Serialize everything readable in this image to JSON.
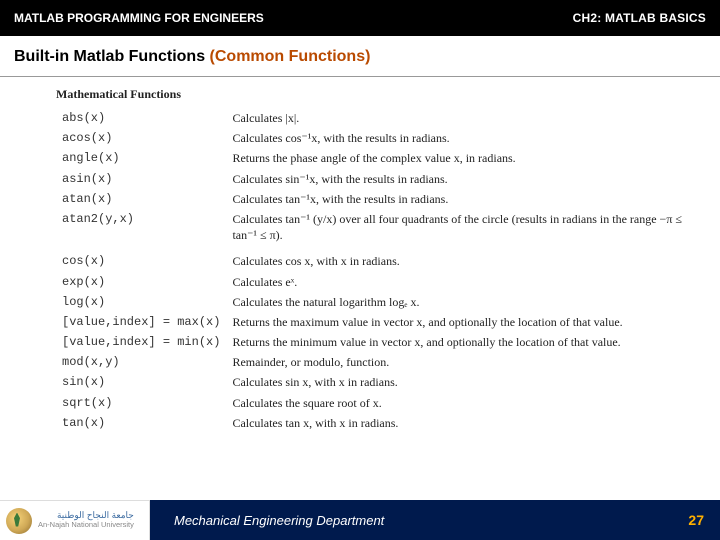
{
  "header": {
    "left": "MATLAB PROGRAMMING FOR ENGINEERS",
    "right_prefix": "CH2: ",
    "right_main": "MATLAB BASICS"
  },
  "title": {
    "main": "Built-in Matlab Functions ",
    "paren": "(Common Functions)"
  },
  "section_heading": "Mathematical Functions",
  "functions": [
    {
      "name": "abs(x)",
      "desc": "Calculates |x|."
    },
    {
      "name": "acos(x)",
      "desc": "Calculates cos⁻¹x, with the results in radians."
    },
    {
      "name": "angle(x)",
      "desc": "Returns the phase angle of the complex value x, in radians."
    },
    {
      "name": "asin(x)",
      "desc": "Calculates sin⁻¹x, with the results in radians."
    },
    {
      "name": "atan(x)",
      "desc": "Calculates tan⁻¹x, with the results in radians."
    },
    {
      "name": "atan2(y,x)",
      "desc": "Calculates tan⁻¹ (y/x) over all four quadrants of the circle (results in radians in the range −π ≤ tan⁻¹ ≤ π)."
    },
    {
      "name": "cos(x)",
      "desc": "Calculates cos x, with x in radians."
    },
    {
      "name": "exp(x)",
      "desc": "Calculates eˣ."
    },
    {
      "name": "log(x)",
      "desc": "Calculates the natural logarithm logₑ x."
    },
    {
      "name": "[value,index] = max(x)",
      "desc": "Returns the maximum value in vector x, and optionally the location of that value."
    },
    {
      "name": "[value,index] = min(x)",
      "desc": "Returns the minimum value in vector x, and optionally the location of that value."
    },
    {
      "name": "mod(x,y)",
      "desc": "Remainder, or modulo, function."
    },
    {
      "name": "sin(x)",
      "desc": "Calculates sin x, with x in radians."
    },
    {
      "name": "sqrt(x)",
      "desc": "Calculates the square root of x."
    },
    {
      "name": "tan(x)",
      "desc": "Calculates tan x, with x in radians."
    }
  ],
  "footer": {
    "logo_ar": "جامعة النجاح الوطنية",
    "logo_en": "An-Najah National University",
    "department": "Mechanical Engineering Department",
    "page": "27"
  }
}
